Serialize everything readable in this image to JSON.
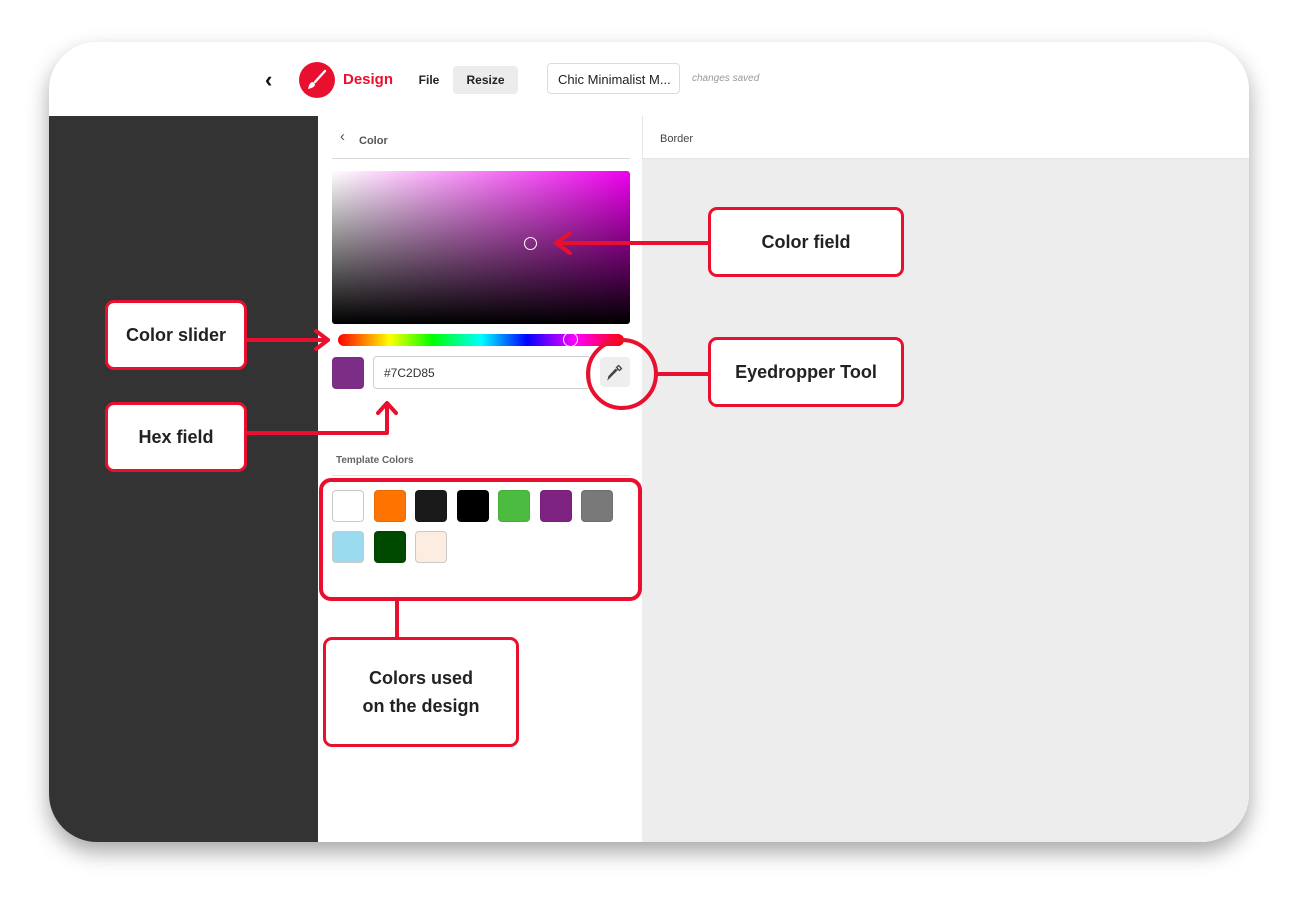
{
  "header": {
    "app_name": "Design",
    "file_label": "File",
    "resize_label": "Resize",
    "document_title": "Chic Minimalist M...",
    "save_status": "changes saved"
  },
  "panel": {
    "title": "Color",
    "hex_value": "#7C2D85",
    "current_color": "#7C2D85",
    "template_colors_title": "Template Colors",
    "template_colors": [
      "#FFFFFF",
      "#FF7300",
      "#1A1A1A",
      "#000000",
      "#4CBC40",
      "#7F2382",
      "#797979",
      "#9BDBEF",
      "#004A00",
      "#FDECE0"
    ]
  },
  "canvas": {
    "border_label": "Border"
  },
  "annotations": {
    "color_field": "Color field",
    "color_slider": "Color slider",
    "eyedropper": "Eyedropper Tool",
    "hex_field": "Hex field",
    "colors_used_line1": "Colors used",
    "colors_used_line2": "on the design"
  },
  "colors": {
    "brand_red": "#E8102E",
    "sidebar_dark": "#333333",
    "canvas_bg": "#EDEDED"
  }
}
